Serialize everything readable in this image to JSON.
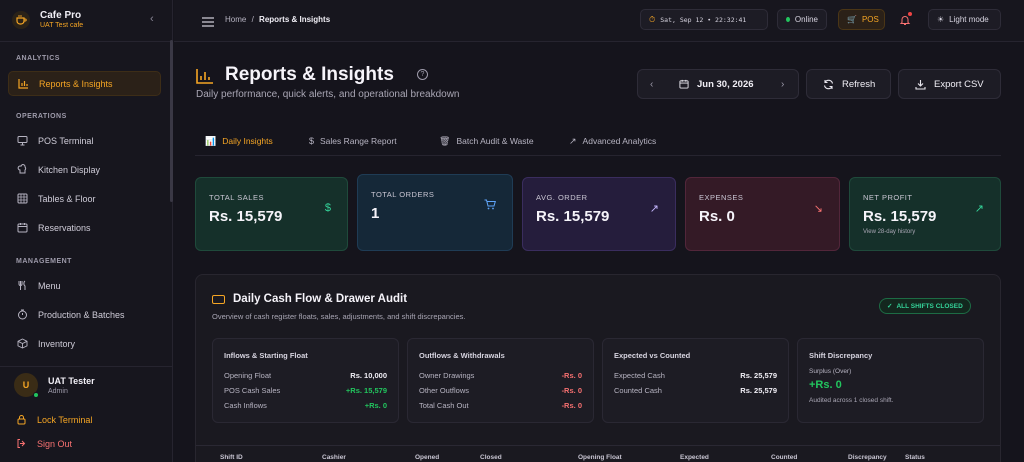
{
  "brand": {
    "name": "Cafe Pro",
    "sub": "UAT Test cafe"
  },
  "sidebar": {
    "sections": [
      "ANALYTICS",
      "OPERATIONS",
      "MANAGEMENT"
    ],
    "items": [
      {
        "label": "Reports & Insights",
        "icon": "bar-chart-icon"
      },
      {
        "label": "POS Terminal",
        "icon": "monitor-icon"
      },
      {
        "label": "Kitchen Display",
        "icon": "chef-icon"
      },
      {
        "label": "Tables & Floor",
        "icon": "grid-icon"
      },
      {
        "label": "Reservations",
        "icon": "calendar-icon"
      },
      {
        "label": "Menu",
        "icon": "utensils-icon"
      },
      {
        "label": "Production & Batches",
        "icon": "timer-icon"
      },
      {
        "label": "Inventory",
        "icon": "box-icon"
      }
    ]
  },
  "user": {
    "initial": "U",
    "name": "UAT Tester",
    "role": "Admin",
    "lock": "Lock Terminal",
    "signout": "Sign Out"
  },
  "topbar": {
    "breadcrumb_home": "Home",
    "breadcrumb_sep": "/",
    "breadcrumb_current": "Reports & Insights",
    "clock": "Sat, Sep 12 • 22:32:41",
    "status": "Online",
    "pos": "POS",
    "theme": "Light mode"
  },
  "page": {
    "title": "Reports & Insights",
    "help": "?",
    "subtitle": "Daily performance, quick alerts, and operational breakdown",
    "date": "Jun 30, 2026",
    "refresh": "Refresh",
    "export": "Export CSV"
  },
  "tabs": [
    {
      "label": "Daily Insights",
      "icon": "bar-chart-icon"
    },
    {
      "label": "Sales Range Report",
      "icon": "dollar-icon"
    },
    {
      "label": "Batch Audit & Waste",
      "icon": "trash-icon"
    },
    {
      "label": "Advanced Analytics",
      "icon": "trend-icon"
    }
  ],
  "cards": [
    {
      "label": "TOTAL SALES",
      "value": "Rs. 15,579",
      "icon": "dollar-icon",
      "color": "#34d399"
    },
    {
      "label": "TOTAL ORDERS",
      "value": "1",
      "icon": "cart-icon",
      "color": "#60a5fa"
    },
    {
      "label": "AVG. ORDER",
      "value": "Rs. 15,579",
      "icon": "trend-up-icon",
      "color": "#c4b5fd"
    },
    {
      "label": "EXPENSES",
      "value": "Rs. 0",
      "icon": "arrow-down-right-icon",
      "color": "#f87171"
    },
    {
      "label": "NET PROFIT",
      "value": "Rs. 15,579",
      "icon": "trend-up-icon",
      "color": "#34d399",
      "note": "View 28-day history"
    }
  ],
  "cashflow": {
    "title": "Daily Cash Flow & Drawer Audit",
    "subtitle": "Overview of cash register floats, sales, adjustments, and shift discrepancies.",
    "badge": "ALL SHIFTS CLOSED",
    "inflows": {
      "title": "Inflows & Starting Float",
      "rows": [
        {
          "label": "Opening Float",
          "value": "Rs. 10,000"
        },
        {
          "label": "POS Cash Sales",
          "value": "+Rs. 15,579"
        },
        {
          "label": "Cash Inflows",
          "value": "+Rs. 0"
        }
      ]
    },
    "outflows": {
      "title": "Outflows & Withdrawals",
      "rows": [
        {
          "label": "Owner Drawings",
          "value": "-Rs. 0"
        },
        {
          "label": "Other Outflows",
          "value": "-Rs. 0"
        },
        {
          "label": "Total Cash Out",
          "value": "-Rs. 0"
        }
      ]
    },
    "expected": {
      "title": "Expected vs Counted",
      "rows": [
        {
          "label": "Expected Cash",
          "value": "Rs. 25,579"
        },
        {
          "label": "Counted Cash",
          "value": "Rs. 25,579"
        }
      ]
    },
    "discrepancy": {
      "title": "Shift Discrepancy",
      "label": "Surplus (Over)",
      "value": "+Rs. 0",
      "note": "Audited across 1 closed shift."
    },
    "columns": [
      "Shift ID",
      "Cashier",
      "Opened",
      "Closed",
      "Opening Float",
      "Expected",
      "Counted",
      "Discrepancy",
      "Status"
    ]
  }
}
